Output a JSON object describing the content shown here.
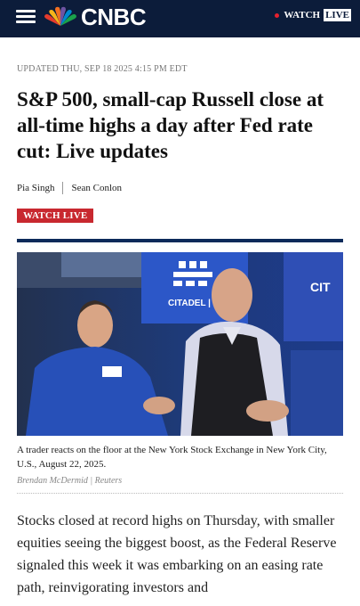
{
  "header": {
    "brand": "CNBC",
    "watch_label": "WATCH",
    "live_label": "LIVE"
  },
  "article": {
    "updated": "UPDATED THU, SEP 18 2025 4:15 PM EDT",
    "headline": "S&P 500, small-cap Russell close at all-time highs a day after Fed rate cut: Live updates",
    "authors": [
      "Pia Singh",
      "Sean Conlon"
    ],
    "watch_live_button": "WATCH LIVE",
    "image_caption": "A trader reacts on the floor at the New York Stock Exchange in New York City, U.S., August 22, 2025.",
    "image_credit": "Brendan McDermid | Reuters",
    "image_sign_1": "CITADEL | S",
    "image_sign_2": "CIT",
    "body": "Stocks closed at record highs on Thursday, with smaller equities seeing the biggest boost, as the Federal Reserve signaled this week it was embarking on an easing rate path, reinvigorating investors and"
  },
  "colors": {
    "header_bg": "#0c1c3a",
    "live_red": "#c8282f",
    "rule_blue": "#0c2a5a"
  }
}
